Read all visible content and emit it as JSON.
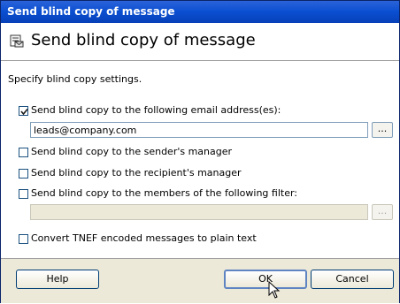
{
  "window": {
    "title": "Send blind copy of message"
  },
  "header": {
    "title": "Send blind copy of message",
    "icon": "bcc-message-icon"
  },
  "instructions": "Specify blind copy settings.",
  "options": {
    "email": {
      "label": "Send blind copy to the following email address(es):",
      "checked": true,
      "value": "leads@company.com",
      "browse_label": "..."
    },
    "sender_manager": {
      "label": "Send blind copy to the sender's manager",
      "checked": false
    },
    "recipient_manager": {
      "label": "Send blind copy to the recipient's manager",
      "checked": false
    },
    "filter": {
      "label": "Send blind copy to the members of the following filter:",
      "checked": false,
      "value": "",
      "browse_label": "..."
    },
    "tnef": {
      "label": "Convert TNEF encoded messages to plain text",
      "checked": false
    }
  },
  "buttons": {
    "help": "Help",
    "ok": "OK",
    "cancel": "Cancel"
  },
  "colors": {
    "title_bar": "#0a4fd1",
    "dialog_bg": "#ece9d8",
    "checkbox_border": "#1c5180",
    "check_mark": "#21a121"
  }
}
